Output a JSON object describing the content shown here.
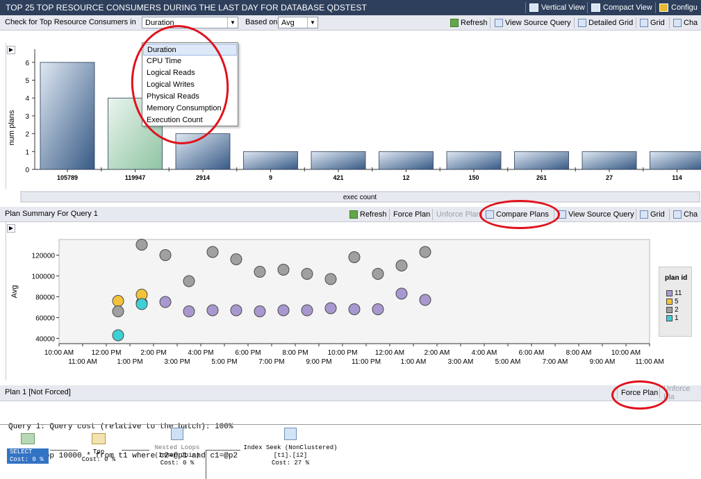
{
  "window": {
    "title": "TOP 25 TOP RESOURCE CONSUMERS DURING THE LAST DAY FOR DATABASE QDSTEST",
    "buttons": [
      "Vertical View",
      "Compact View",
      "Configu"
    ]
  },
  "top_toolbar": {
    "check_label": "Check for Top Resource Consumers in",
    "metric_value": "Duration",
    "based_on_label": "Based on",
    "statistic_value": "Avg",
    "buttons": [
      "Refresh",
      "View Source Query",
      "Detailed Grid",
      "Grid",
      "Cha"
    ]
  },
  "metric_dropdown": {
    "options": [
      "Duration",
      "CPU Time",
      "Logical Reads",
      "Logical Writes",
      "Physical Reads",
      "Memory Consumption",
      "Execution Count"
    ],
    "selected": "Duration"
  },
  "chart_data": [
    {
      "type": "bar",
      "ylabel": "num plans",
      "xlabel": "exec count",
      "categories": [
        "105789",
        "119947",
        "2914",
        "9",
        "421",
        "12",
        "150",
        "261",
        "27",
        "114"
      ],
      "values": [
        6,
        4,
        2,
        1,
        1,
        1,
        1,
        1,
        1,
        1
      ],
      "highlighted_index": 1,
      "yticks": [
        0,
        1,
        2,
        3,
        4,
        5,
        6
      ],
      "ylim": [
        0,
        6.5
      ]
    },
    {
      "type": "scatter",
      "ylabel": "Avg",
      "yticks": [
        40000,
        60000,
        80000,
        100000,
        120000
      ],
      "ylim": [
        35000,
        135000
      ],
      "xticks_top": [
        "10:00 AM",
        "12:00 PM",
        "2:00 PM",
        "4:00 PM",
        "6:00 PM",
        "8:00 PM",
        "10:00 PM",
        "12:00 AM",
        "2:00 AM",
        "4:00 AM",
        "6:00 AM",
        "8:00 AM",
        "10:00 AM"
      ],
      "xticks_bottom": [
        "11:00 AM",
        "1:00 PM",
        "3:00 PM",
        "5:00 PM",
        "7:00 PM",
        "9:00 PM",
        "11:00 PM",
        "1:00 AM",
        "3:00 AM",
        "5:00 AM",
        "7:00 AM",
        "9:00 AM",
        "11:00 AM"
      ],
      "x_range_hours": [
        10,
        35
      ],
      "legend_title": "plan id",
      "series": [
        {
          "name": "11",
          "color": "#a898cf",
          "points": [
            [
              13.5,
              74000
            ],
            [
              14.5,
              75000
            ],
            [
              15.5,
              66000
            ],
            [
              16.5,
              67000
            ],
            [
              17.5,
              67000
            ],
            [
              18.5,
              66000
            ],
            [
              19.5,
              67000
            ],
            [
              20.5,
              67000
            ],
            [
              21.5,
              69000
            ],
            [
              22.5,
              68000
            ],
            [
              23.5,
              68000
            ],
            [
              24.5,
              83000
            ],
            [
              25.5,
              77000
            ]
          ]
        },
        {
          "name": "5",
          "color": "#f2c33a",
          "points": [
            [
              12.5,
              76000
            ],
            [
              13.5,
              82000
            ]
          ]
        },
        {
          "name": "2",
          "color": "#a0a0a0",
          "points": [
            [
              12.5,
              66000
            ],
            [
              13.5,
              130000
            ],
            [
              14.5,
              120000
            ],
            [
              15.5,
              95000
            ],
            [
              16.5,
              123000
            ],
            [
              17.5,
              116000
            ],
            [
              18.5,
              104000
            ],
            [
              19.5,
              106000
            ],
            [
              20.5,
              102000
            ],
            [
              21.5,
              97000
            ],
            [
              22.5,
              118000
            ],
            [
              23.5,
              102000
            ],
            [
              24.5,
              110000
            ],
            [
              25.5,
              123000
            ]
          ]
        },
        {
          "name": "1",
          "color": "#3ed0d4",
          "points": [
            [
              12.5,
              43000
            ],
            [
              13.5,
              73000
            ]
          ]
        }
      ]
    }
  ],
  "plan_summary": {
    "title": "Plan Summary For Query 1",
    "buttons": [
      "Refresh",
      "Force Plan",
      "Unforce Plan",
      "Compare Plans",
      "View Source Query",
      "Grid",
      "Cha"
    ]
  },
  "plan_panel": {
    "title": "Plan 1 [Not Forced]",
    "force_label": "Force Plan",
    "unforce_label": "Unforce Pla",
    "query_line1": "Query 1: Query cost (relative to the batch): 100%",
    "query_line2": "select top 10000 * from t1 where c2=@p1 and c1=@p2",
    "nodes": [
      {
        "label": "SELECT",
        "sub": "",
        "cost": "Cost: 0 %"
      },
      {
        "label": "Top",
        "sub": "",
        "cost": "Cost: 0 %"
      },
      {
        "label": "Nested Loops",
        "sub": "(Inner Join)",
        "cost": "Cost: 0 %"
      },
      {
        "label": "Index Seek (NonClustered)",
        "sub": "[t1].[i2]",
        "cost": "Cost: 27 %"
      }
    ]
  },
  "colors": {
    "titlebar": "#2e3f5c",
    "bar_fill": "#375a85",
    "bar_highlight": "#8fc4a2",
    "annotation": "#e0111b"
  }
}
